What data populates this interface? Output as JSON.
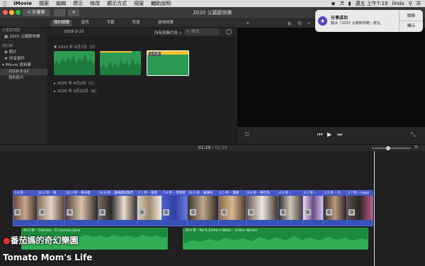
{
  "menubar": {
    "app": "iMovie",
    "items": [
      "檔案",
      "編輯",
      "標示",
      "修改",
      "顯示方式",
      "視窗",
      "輔助說明"
    ],
    "clock": "週五 上午7:19",
    "user": "linda"
  },
  "window": {
    "back_label": "< 計畫案",
    "title": "2020 父親節快樂"
  },
  "tabs": [
    "我的媒體",
    "音訊",
    "字幕",
    "背景",
    "過場效果"
  ],
  "sidebar": {
    "project_head": "計畫案媒體",
    "project_item": "2020 父親節快樂",
    "library_head": "資料庫",
    "items": [
      "照片",
      "所有事件",
      "iMovie 資料庫",
      "2018-3-22",
      "我的影片"
    ]
  },
  "browser": {
    "event_name": "2018-3-22",
    "filter_label": "所有剪輯片段 ◇",
    "search_placeholder": "搜尋",
    "group1": "▼ 2020 年 8月7日（3）",
    "group2": "▸ 2020 年 4月2日（1）",
    "group3": "▸ 2020 年 3月22日（6）",
    "clip3_badge": "2.6 秒"
  },
  "notification": {
    "title": "分享成功",
    "body": "輸出「2020 父親節快樂」成功。",
    "close": "關閉",
    "show": "顯示"
  },
  "timeline": {
    "time_current": "01:29",
    "time_total": "01:29",
    "video_clips": [
      {
        "label": "3.9 秒 –"
      },
      {
        "label": "10.2 秒 – 冊"
      },
      {
        "label": "10.3 秒 – 每天都"
      },
      {
        "label": "14.8 秒 – 還要都對我們"
      },
      {
        "label": "7.1 秒 – 爸爸"
      },
      {
        "label": "7.4 秒 – 世爸爸"
      },
      {
        "label": "19.2 秒 – 謝謝你"
      },
      {
        "label": "6.5 秒 – 還要"
      },
      {
        "label": "9.6 秒 – 看在你"
      },
      {
        "label": "4.6 秒 –"
      },
      {
        "label": "4.1 秒 –"
      },
      {
        "label": "3.5 秒 – 同"
      },
      {
        "label": "3.7 秒 – Happ"
      }
    ],
    "music1": "46.2 秒 – Calimba – E's Jammy Jams",
    "music2": "36.9 秒 – No.9_Esther's Waltz – Esther Abrami"
  },
  "watermark": {
    "line1": "番茄媽的奇幻樂園",
    "line2": "Tomato Mom's Life"
  },
  "colors": {
    "clip_blue": "#3a4ab0",
    "audio_green": "#1c8a3c",
    "accent_yellow": "#f2c12e"
  }
}
